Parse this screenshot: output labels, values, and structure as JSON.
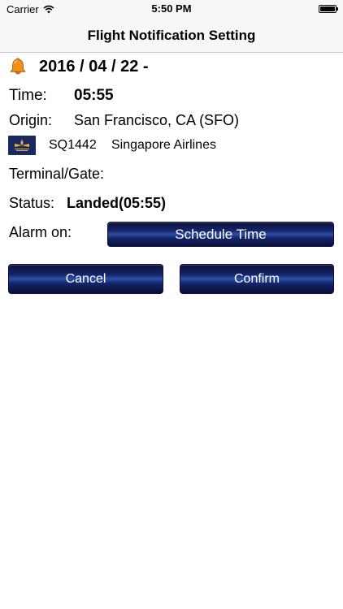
{
  "status_bar": {
    "carrier": "Carrier",
    "time": "5:50 PM"
  },
  "nav": {
    "title": "Flight Notification Setting"
  },
  "flight": {
    "date": "2016 / 04 / 22 -",
    "time_label": "Time:",
    "time_value": "05:55",
    "origin_label": "Origin:",
    "origin_value": "San Francisco, CA (SFO)",
    "flight_number": "SQ1442",
    "airline": "Singapore Airlines",
    "terminal_label": "Terminal/Gate:",
    "status_label": "Status:",
    "status_value": "Landed(05:55)"
  },
  "alarm": {
    "label": "Alarm on:",
    "selected": "Schedule Time"
  },
  "buttons": {
    "cancel": "Cancel",
    "confirm": "Confirm"
  },
  "colors": {
    "button_dark": "#0a0f3a",
    "button_highlight": "#2a52a8",
    "airline_logo_bg": "#1a2a5e",
    "bell": "#f0901a"
  },
  "icons": {
    "alarm": "bell-icon",
    "wifi": "wifi-icon",
    "battery": "battery-icon",
    "airline": "airline-logo-icon"
  }
}
